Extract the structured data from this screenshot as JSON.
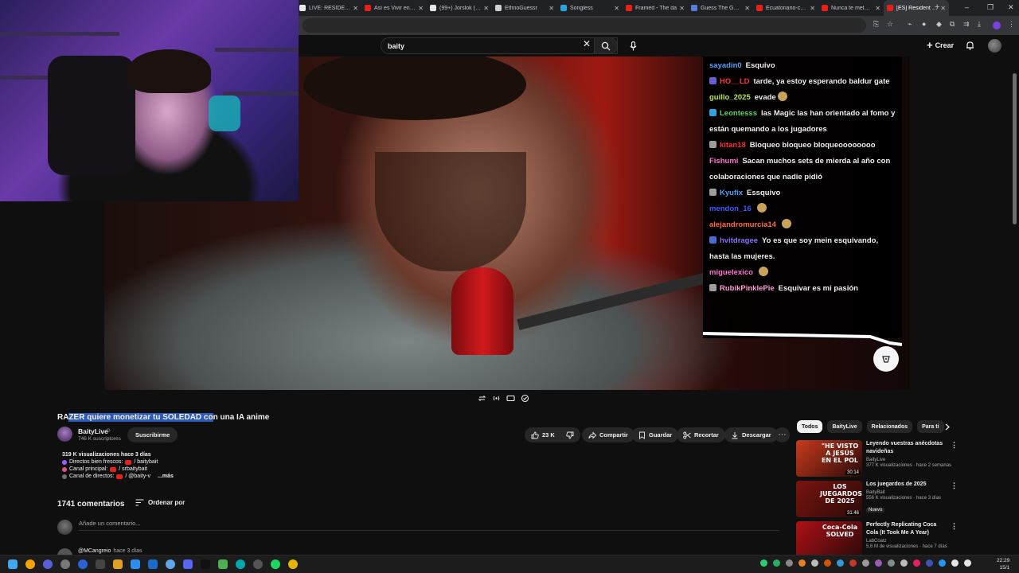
{
  "browser": {
    "tabs": [
      {
        "title": "LIVE: RESIDENT",
        "favicon_color": "#e8e8e8"
      },
      {
        "title": "Así es Vivir en un",
        "favicon_color": "#e62117"
      },
      {
        "title": "(99+) Jorslok (@c",
        "favicon_color": "#e8e8e8"
      },
      {
        "title": "EthnoGuessr",
        "favicon_color": "#cfcfcf"
      },
      {
        "title": "Songless",
        "favicon_color": "#2aa5e0"
      },
      {
        "title": "Framed - The da",
        "favicon_color": "#e62117"
      },
      {
        "title": "Guess The Game",
        "favicon_color": "#5b7bd5"
      },
      {
        "title": "Ecuatoriano-cata",
        "favicon_color": "#e62117"
      },
      {
        "title": "Nunca te metas c",
        "favicon_color": "#e62117"
      },
      {
        "title": "[ES] Resident Evi",
        "favicon_color": "#e62117"
      }
    ],
    "active_tab_index": 9,
    "new_tab_symbol": "+",
    "window_controls": [
      "–",
      "❐",
      "✕"
    ]
  },
  "masthead": {
    "search_query": "baity",
    "create_label": "Crear"
  },
  "chat": {
    "messages": [
      {
        "user": "sayadin0",
        "user_color": "#4aa3ff",
        "text": "Esquivo",
        "badge_color": ""
      },
      {
        "user": "HO__LD",
        "user_color": "#ff3333",
        "text": "tarde, ya estoy esperando baldur gate",
        "badge_color": "#6b5bd5"
      },
      {
        "user": "guillo_2025",
        "user_color": "#b7e34a",
        "text": "evade",
        "badge_color": "",
        "emote": true
      },
      {
        "user": "Leontesss",
        "user_color": "#57d357",
        "text": "las Magic las han orientado al fomo y están quemando a los jugadores",
        "badge_color": "#2aa5e0"
      },
      {
        "user": "kitan18",
        "user_color": "#ff2a2a",
        "text": "Bloqueo bloqueo bloqueoooooooo",
        "badge_color": "#9d9d9d"
      },
      {
        "user": "Fishumi",
        "user_color": "#ff6fd0",
        "text": "Sacan muchos sets de mierda al año con colaboraciones que nadie pidió",
        "badge_color": ""
      },
      {
        "user": "Kyufix",
        "user_color": "#4aa3ff",
        "text": "Essquivo",
        "badge_color": "#9d9d9d"
      },
      {
        "user": "mendon_16",
        "user_color": "#3a5bff",
        "text": "",
        "badge_color": "",
        "emote": true
      },
      {
        "user": "alejandromurcia14",
        "user_color": "#ff6a3d",
        "text": "",
        "badge_color": "",
        "emote": true
      },
      {
        "user": "hvitdragee",
        "user_color": "#8a6bff",
        "text": "Yo es que soy mein esquivando, hasta las mujeres.",
        "badge_color": "#4a6bd5"
      },
      {
        "user": "miguelexico",
        "user_color": "#ff6fd0",
        "text": "",
        "badge_color": "",
        "emote": true
      },
      {
        "user": "RubikPinklePie",
        "user_color": "#ff9ad5",
        "text": "Esquivar es mi pasión",
        "badge_color": "#9d9d9d"
      }
    ]
  },
  "video": {
    "title_selected": "ZER quiere monetizar tu SOLEDAD co",
    "title_prefix": "RA",
    "title_suffix": "n una IA anime",
    "channel": {
      "name": "BaityLive",
      "subscribers": "746 K suscriptores",
      "verified_symbol": "⊙"
    },
    "subscribe_label": "Suscribirme",
    "likes": "23 K",
    "actions": {
      "share": "Compartir",
      "save": "Guardar",
      "clip": "Recortar",
      "download": "Descargar"
    },
    "description": {
      "stats": "319 K visualizaciones  hace 3 días",
      "lines": [
        {
          "icon_color": "#9b59ff",
          "text": "Directos bien frescos:",
          "link": " / baitybait"
        },
        {
          "icon_color": "#e44d8c",
          "text": "Canal principal:",
          "link": " / srbaitybait"
        },
        {
          "icon_color": "#6e6e6e",
          "text": "Canal de directos:",
          "link": " / @baity-v"
        }
      ],
      "more_label": "...más"
    }
  },
  "comments": {
    "count_label": "1741 comentarios",
    "sort_label": "Ordenar por",
    "placeholder": "Añade un comentario...",
    "first": {
      "author": "@MCangreio",
      "when": "hace 3 días"
    }
  },
  "sidebar": {
    "chips": [
      "Todos",
      "BaityLive",
      "Relacionados",
      "Para ti"
    ],
    "active_chip_index": 0,
    "recommendations": [
      {
        "title": "Leyendo vuestras anécdotas navideñas",
        "channel": "BaityLive",
        "meta": "377 K visualizaciones · hace 2 semanas",
        "duration": "30:14",
        "thumb_text": "\"HE VISTO A JESÚS EN EL POL",
        "thumb_bg": "#c93a1e",
        "badge": ""
      },
      {
        "title": "Los juegardos de 2025",
        "channel": "BaityBait",
        "meta": "556 K visualizaciones · hace 3 días",
        "duration": "31:46",
        "thumb_text": "LOS JUEGARDOS DE 2025",
        "thumb_bg": "#7a1410",
        "badge": "Nuevo"
      },
      {
        "title": "Perfectly Replicating Coca Cola (It Took Me A Year)",
        "channel": "LabCoatz",
        "meta": "5,6 M de visualizaciones · hace 7 días",
        "duration": "",
        "thumb_text": "Coca-Cola SOLVED",
        "thumb_bg": "#b01018",
        "badge": ""
      }
    ]
  },
  "taskbar": {
    "clock_time": "22:29",
    "clock_date": "15/1"
  }
}
